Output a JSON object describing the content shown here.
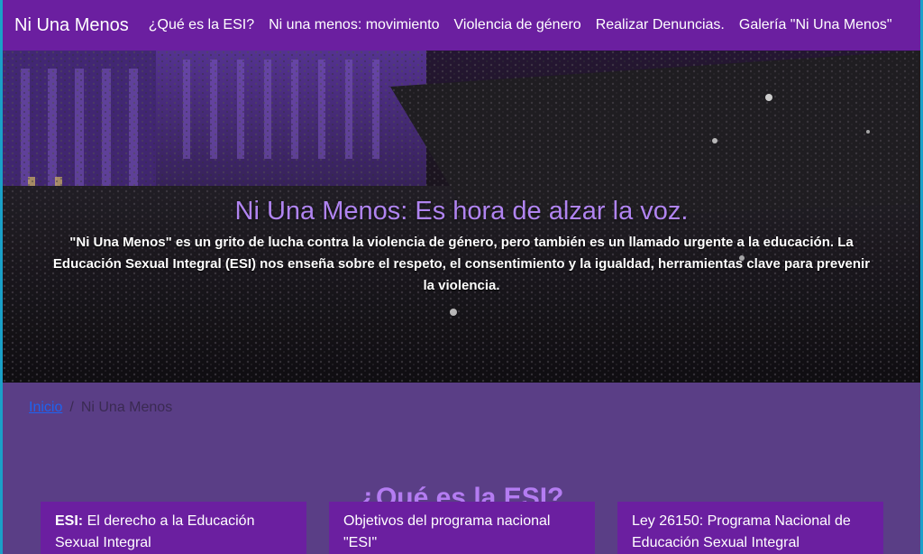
{
  "navbar": {
    "brand": "Ni Una Menos",
    "links": [
      "¿Qué es la ESI?",
      "Ni una menos: movimiento",
      "Violencia de género",
      "Realizar Denuncias.",
      "Galería \"Ni Una Menos\""
    ]
  },
  "hero": {
    "title": "Ni Una Menos: Es hora de alzar la voz.",
    "text": "\"Ni Una Menos\" es un grito de lucha contra la violencia de género, pero también es un llamado urgente a la educación. La Educación Sexual Integral (ESI) nos enseña sobre el respeto, el consentimiento y la igualdad, herramientas clave para prevenir la violencia."
  },
  "breadcrumb": {
    "home": "Inicio",
    "separator": "/",
    "current": "Ni Una Menos"
  },
  "section": {
    "title": "¿Qué es la ESI?",
    "cards": [
      {
        "bold": "ESI:",
        "text": " El derecho a la Educación Sexual Integral"
      },
      {
        "bold": "",
        "text": "Objetivos del programa nacional \"ESI\""
      },
      {
        "bold": "",
        "text": "Ley 26150: Programa Nacional de Educación Sexual Integral"
      }
    ]
  },
  "colors": {
    "navbar": "#6b1fa0",
    "page_background": "#5a3e86",
    "accent_title": "#b084f0",
    "link": "#1e63f0"
  }
}
